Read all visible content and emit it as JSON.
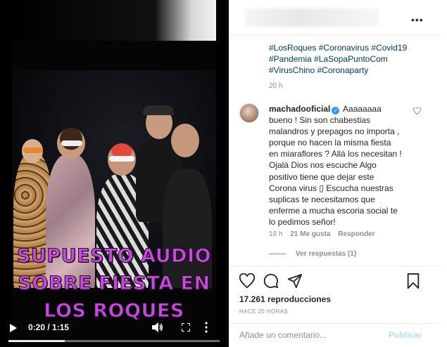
{
  "video": {
    "overlay_caption": [
      "SUPUESTO AUDIO",
      "SOBRE FIESTA EN",
      "LOS ROQUES"
    ],
    "time": "0:20 / 1:15",
    "progress": 0.267
  },
  "post": {
    "hashtags": [
      "#LosRoques #Coronavirus #Covid19",
      "#Pandemia #LaSopaPuntoCom",
      "#VirusChino #Coronaparty"
    ],
    "time_ago": "20 h"
  },
  "comment": {
    "username": "machadooficial",
    "verified_glyph": "✓",
    "text": "Aaaaaaaa bueno ! Sin son chabestias malandros y prepagos no importa , porque no hacen la misma fiesta en miaraflores ? Allá los necesitan ! Ojalá Dios nos escuche Algo positivo tiene que dejar este Corona virus ▯ Escucha nuestras suplicas te necesitamos que enferme a mucha escoria social te lo pedimos señor!",
    "time": "18 h",
    "likes": "21 Me gusta",
    "reply_label": "Responder",
    "view_replies": "Ver respuestas (1)"
  },
  "stats": {
    "views": "17.261 reproducciones",
    "posted_ago": "HACE 20 HORAS"
  },
  "composer": {
    "placeholder": "Añade un comentario...",
    "publish_label": "Publicar"
  },
  "header": {
    "more_glyph": "•••"
  },
  "icons": {
    "play": "play-icon",
    "volume": "volume-icon",
    "fullscreen": "fullscreen-icon",
    "more": "more-vertical-icon",
    "heart": "heart-icon",
    "comment": "comment-icon",
    "share": "share-icon",
    "save": "bookmark-icon"
  },
  "colors": {
    "caption": "#c04fd6",
    "link": "#00376b",
    "verified": "#3897f0",
    "publish_disabled": "#b2dffc"
  }
}
